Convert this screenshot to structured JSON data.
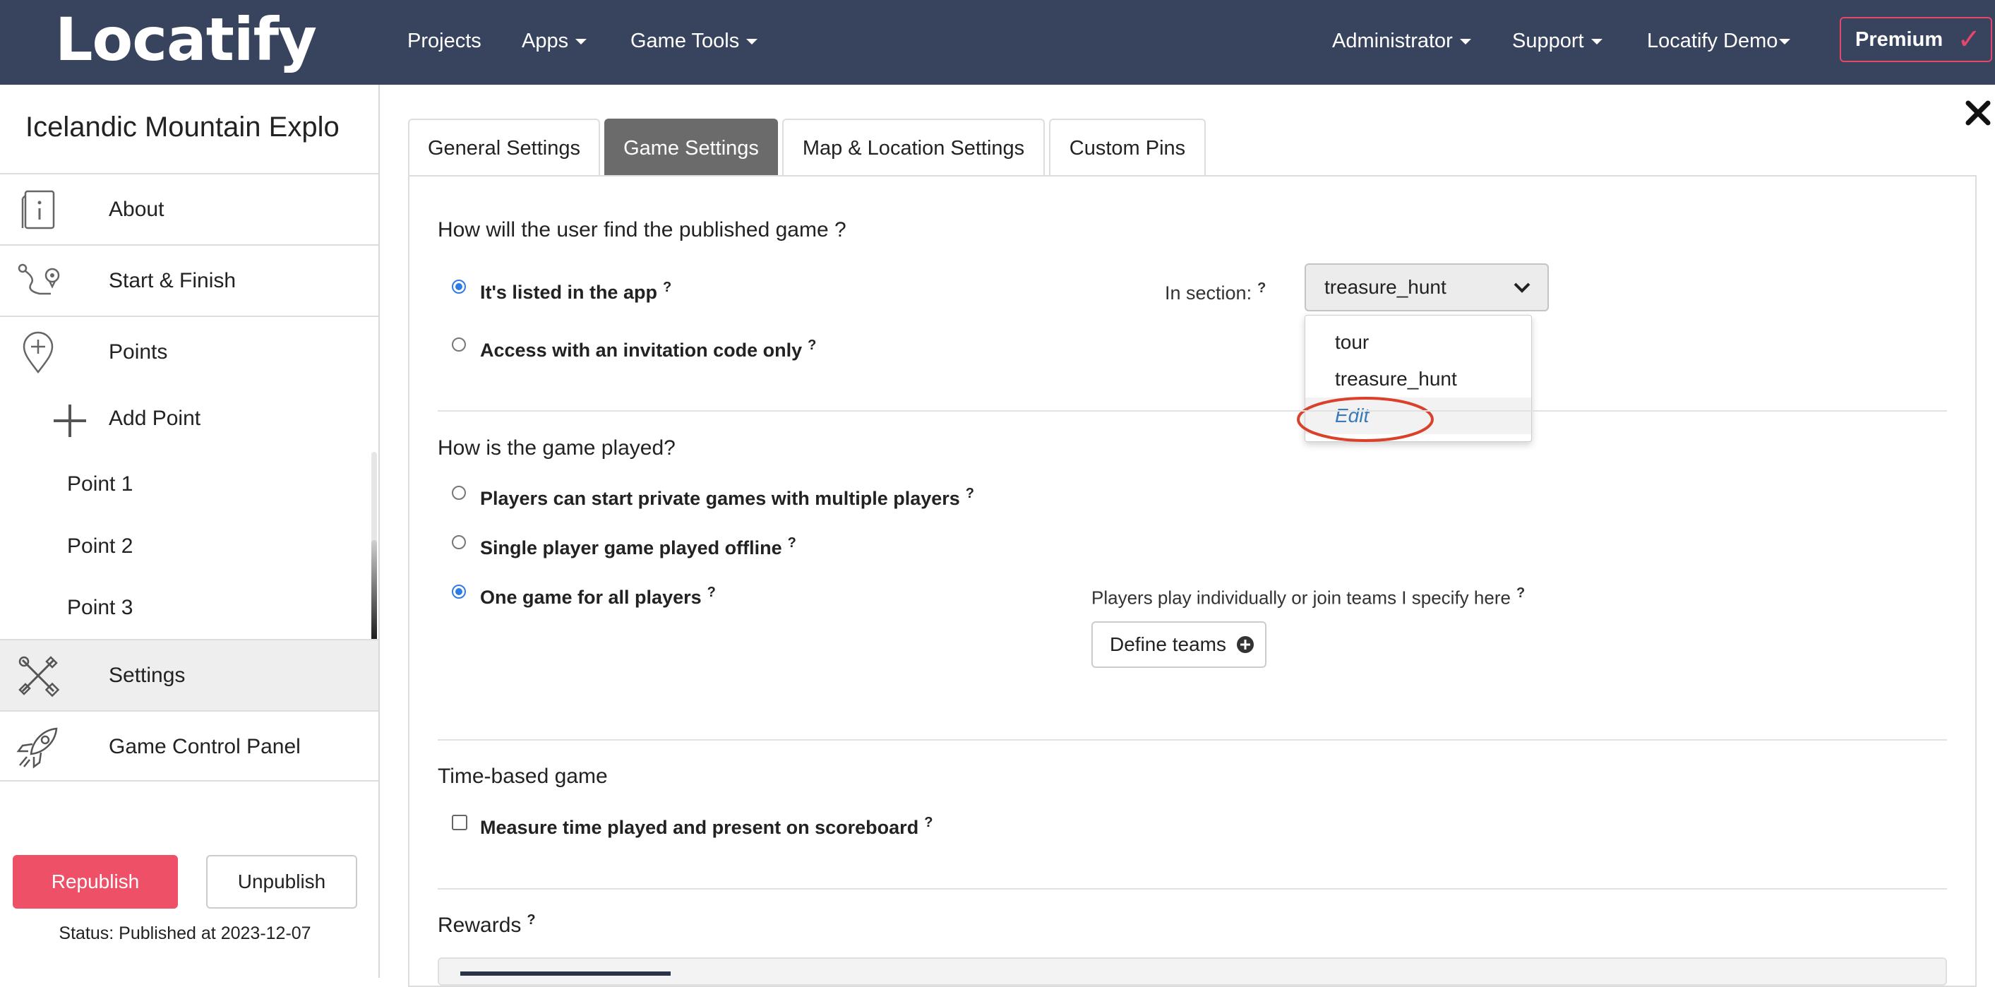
{
  "navbar": {
    "logo": "Locatify",
    "items": [
      {
        "label": "Projects",
        "dropdown": false
      },
      {
        "label": "Apps",
        "dropdown": true
      },
      {
        "label": "Game Tools",
        "dropdown": true
      },
      {
        "label": "Administrator",
        "dropdown": true
      },
      {
        "label": "Support",
        "dropdown": true
      },
      {
        "label": "Locatify Demo",
        "dropdown": true
      }
    ],
    "premium": {
      "label": "Premium",
      "check": "✓"
    }
  },
  "sidebar": {
    "project_title": "Icelandic Mountain Explo",
    "items": [
      {
        "label": "About",
        "icon": "info-icon"
      },
      {
        "label": "Start & Finish",
        "icon": "route-icon"
      },
      {
        "label": "Points",
        "icon": "map-pin-plus-icon"
      }
    ],
    "add_point": "Add Point",
    "points": [
      "Point 1",
      "Point 2",
      "Point 3"
    ],
    "settings": {
      "label": "Settings",
      "icon": "tools-icon"
    },
    "game_control": {
      "label": "Game Control Panel",
      "icon": "rocket-icon"
    },
    "republish": "Republish",
    "unpublish": "Unpublish",
    "status": "Status: Published at 2023-12-07"
  },
  "tabs": [
    {
      "label": "General Settings",
      "active": false
    },
    {
      "label": "Game Settings",
      "active": true
    },
    {
      "label": "Map & Location Settings",
      "active": false
    },
    {
      "label": "Custom Pins",
      "active": false
    }
  ],
  "find": {
    "title": "How will the user find the published game ?",
    "options": [
      {
        "label": "It's listed in the app",
        "checked": true
      },
      {
        "label": "Access with an invitation code only",
        "checked": false
      }
    ],
    "in_section_label": "In section:",
    "section_value": "treasure_hunt",
    "dropdown_options": [
      "tour",
      "treasure_hunt",
      "Edit"
    ]
  },
  "played": {
    "title": "How is the game played?",
    "options": [
      {
        "label": "Players can start private games with multiple players",
        "checked": false
      },
      {
        "label": "Single player game played offline",
        "checked": false
      },
      {
        "label": "One game for all players",
        "checked": true
      }
    ],
    "teams_text": "Players play individually or join teams I specify here",
    "define_teams": "Define teams"
  },
  "time_based": {
    "title": "Time-based game",
    "measure_label": "Measure time played and present on scoreboard",
    "checked": false
  },
  "rewards": {
    "title": "Rewards"
  },
  "help_mark": "?",
  "colors": {
    "navbar": "#38435e",
    "accent_pink": "#ee5068",
    "radio_blue": "#2f7de1",
    "annotation_red": "#d9412b"
  }
}
